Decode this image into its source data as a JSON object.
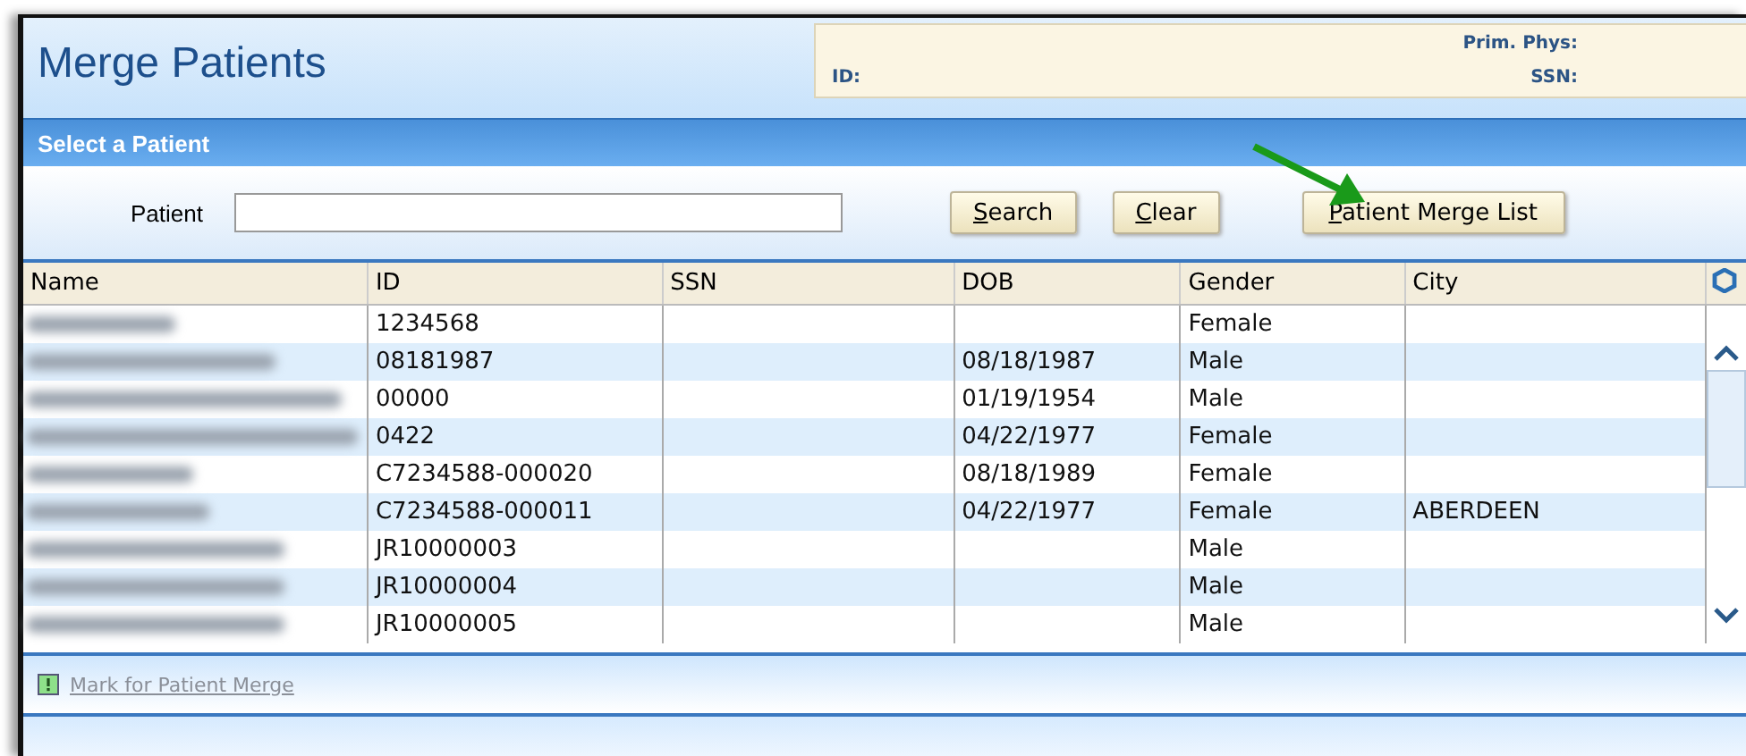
{
  "window": {
    "title": "Merge Patients"
  },
  "info_panel": {
    "fields": [
      {
        "label": "Prim. Phys:"
      },
      {
        "label": "ID:"
      },
      {
        "label": "SSN:"
      }
    ]
  },
  "section": {
    "title": "Select a Patient"
  },
  "search": {
    "label": "Patient"
  },
  "buttons": [
    {
      "label": "Search"
    },
    {
      "label": "Clear"
    },
    {
      "label": "Patient Merge List"
    }
  ],
  "table": {
    "columns": [
      "Name",
      "ID",
      "SSN",
      "DOB",
      "Gender",
      "City"
    ],
    "rows": [
      {
        "id": "1234568",
        "gender": "Female"
      },
      {
        "id": "08181987",
        "dob": "08/18/1987",
        "gender": "Male"
      },
      {
        "id": "00000",
        "dob": "01/19/1954",
        "gender": "Male"
      },
      {
        "id": "0422",
        "dob": "04/22/1977",
        "gender": "Female"
      },
      {
        "id": "C7234588-000020",
        "dob": "08/18/1989",
        "gender": "Female"
      },
      {
        "id": "C7234588-000011",
        "dob": "04/22/1977",
        "gender": "Female",
        "city": "ABERDEEN"
      },
      {
        "id": "JR10000003",
        "gender": "Male"
      },
      {
        "id": "JR10000004",
        "gender": "Male"
      },
      {
        "id": "JR10000005",
        "gender": "Male"
      }
    ]
  },
  "footer": {
    "link": "Mark for Patient Merge",
    "disabled": true
  }
}
